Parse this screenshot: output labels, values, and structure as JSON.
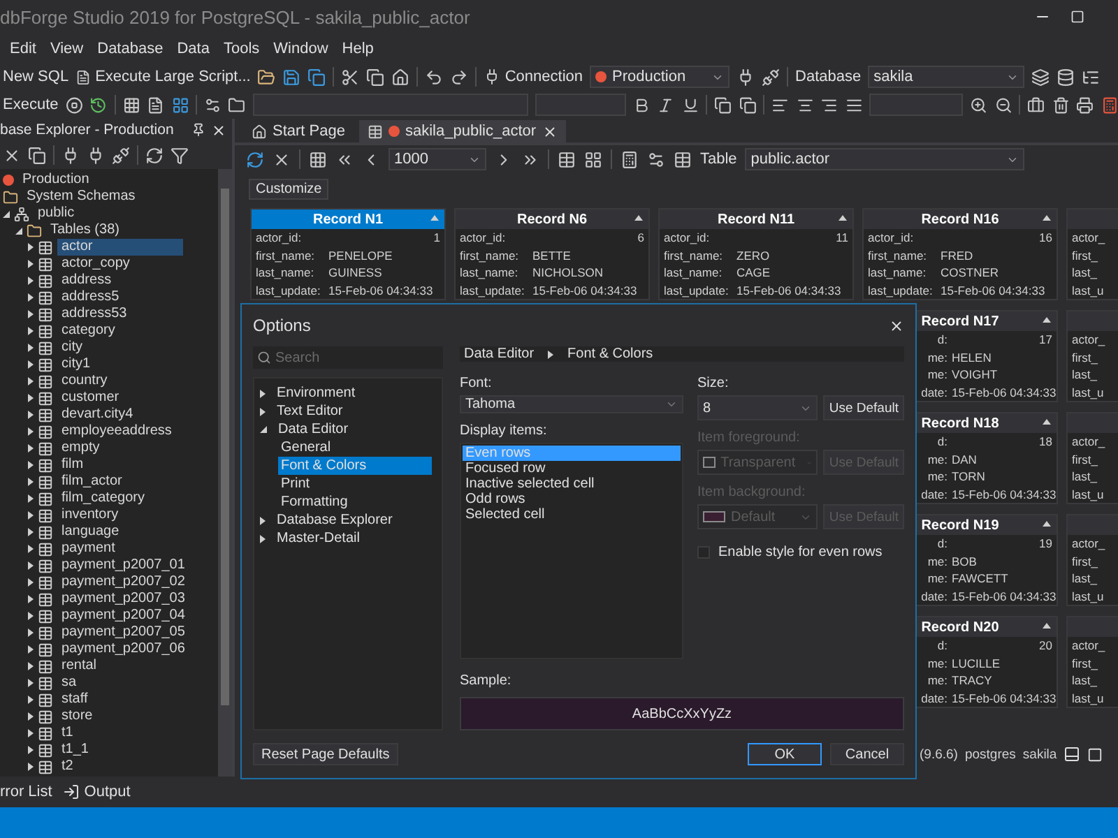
{
  "window": {
    "title": "dbForge Studio 2019 for PostgreSQL - sakila_public_actor"
  },
  "menu": [
    "Edit",
    "View",
    "Database",
    "Data",
    "Tools",
    "Window",
    "Help"
  ],
  "toolbar": {
    "new_sql": "New SQL",
    "execute_large_script": "Execute Large Script...",
    "connection_label": "Connection",
    "connection": "Production",
    "database_label": "Database",
    "database": "sakila",
    "execute": "Execute"
  },
  "explorer": {
    "title": "base Explorer - Production",
    "tree": [
      {
        "label": "Production",
        "kind": "connection",
        "selected": false
      },
      {
        "label": "System Schemas",
        "kind": "folder",
        "selected": false
      },
      {
        "label": "public",
        "kind": "schema",
        "expanded": true,
        "selected": false,
        "children": [
          {
            "label": "Tables (38)",
            "kind": "folder",
            "expanded": true,
            "selected": false,
            "children": [
              {
                "label": "actor",
                "kind": "table",
                "expanded": false,
                "selected": true
              },
              {
                "label": "actor_copy",
                "kind": "table",
                "expanded": false,
                "selected": false
              },
              {
                "label": "address",
                "kind": "table",
                "expanded": false,
                "selected": false
              },
              {
                "label": "address5",
                "kind": "table",
                "expanded": false,
                "selected": false
              },
              {
                "label": "address53",
                "kind": "table",
                "expanded": false,
                "selected": false
              },
              {
                "label": "category",
                "kind": "table",
                "expanded": false,
                "selected": false
              },
              {
                "label": "city",
                "kind": "table",
                "expanded": false,
                "selected": false
              },
              {
                "label": "city1",
                "kind": "table",
                "expanded": false,
                "selected": false
              },
              {
                "label": "country",
                "kind": "table",
                "expanded": false,
                "selected": false
              },
              {
                "label": "customer",
                "kind": "table",
                "expanded": false,
                "selected": false
              },
              {
                "label": "devart.city4",
                "kind": "table",
                "expanded": false,
                "selected": false
              },
              {
                "label": "employeeaddress",
                "kind": "table",
                "expanded": false,
                "selected": false
              },
              {
                "label": "empty",
                "kind": "table",
                "expanded": false,
                "selected": false
              },
              {
                "label": "film",
                "kind": "table",
                "expanded": false,
                "selected": false
              },
              {
                "label": "film_actor",
                "kind": "table",
                "expanded": false,
                "selected": false
              },
              {
                "label": "film_category",
                "kind": "table",
                "expanded": false,
                "selected": false
              },
              {
                "label": "inventory",
                "kind": "table",
                "expanded": false,
                "selected": false
              },
              {
                "label": "language",
                "kind": "table",
                "expanded": false,
                "selected": false
              },
              {
                "label": "payment",
                "kind": "table",
                "expanded": false,
                "selected": false
              },
              {
                "label": "payment_p2007_01",
                "kind": "table",
                "expanded": false,
                "selected": false
              },
              {
                "label": "payment_p2007_02",
                "kind": "table",
                "expanded": false,
                "selected": false
              },
              {
                "label": "payment_p2007_03",
                "kind": "table",
                "expanded": false,
                "selected": false
              },
              {
                "label": "payment_p2007_04",
                "kind": "table",
                "expanded": false,
                "selected": false
              },
              {
                "label": "payment_p2007_05",
                "kind": "table",
                "expanded": false,
                "selected": false
              },
              {
                "label": "payment_p2007_06",
                "kind": "table",
                "expanded": false,
                "selected": false
              },
              {
                "label": "rental",
                "kind": "table",
                "expanded": false,
                "selected": false
              },
              {
                "label": "sa",
                "kind": "table",
                "expanded": false,
                "selected": false
              },
              {
                "label": "staff",
                "kind": "table",
                "expanded": false,
                "selected": false
              },
              {
                "label": "store",
                "kind": "table",
                "expanded": false,
                "selected": false
              },
              {
                "label": "t1",
                "kind": "table",
                "expanded": false,
                "selected": false
              },
              {
                "label": "t1_1",
                "kind": "table",
                "expanded": false,
                "selected": false
              },
              {
                "label": "t2",
                "kind": "table",
                "expanded": false,
                "selected": false
              }
            ]
          }
        ]
      }
    ]
  },
  "tabs": [
    {
      "label": "Start Page",
      "selected": false
    },
    {
      "label": "sakila_public_actor",
      "selected": true
    }
  ],
  "data_toolbar": {
    "row_limit": "1000",
    "table_label": "Table",
    "table": "public.actor",
    "customize": "Customize"
  },
  "record_rows": [
    {
      "cards": [
        {
          "title": "Record N1",
          "selected": true,
          "fields": [
            {
              "label": "actor_id:",
              "value": "1",
              "kind": "number"
            },
            {
              "label": "first_name:",
              "value": "PENELOPE"
            },
            {
              "label": "last_name:",
              "value": "GUINESS"
            },
            {
              "label": "last_update:",
              "value": "15-Feb-06 04:34:33"
            }
          ]
        },
        {
          "title": "Record N6",
          "selected": false,
          "fields": [
            {
              "label": "actor_id:",
              "value": "6",
              "kind": "number"
            },
            {
              "label": "first_name:",
              "value": "BETTE"
            },
            {
              "label": "last_name:",
              "value": "NICHOLSON"
            },
            {
              "label": "last_update:",
              "value": "15-Feb-06 04:34:33"
            }
          ]
        },
        {
          "title": "Record N11",
          "selected": false,
          "fields": [
            {
              "label": "actor_id:",
              "value": "11",
              "kind": "number"
            },
            {
              "label": "first_name:",
              "value": "ZERO"
            },
            {
              "label": "last_name:",
              "value": "CAGE"
            },
            {
              "label": "last_update:",
              "value": "15-Feb-06 04:34:33"
            }
          ]
        },
        {
          "title": "Record N16",
          "selected": false,
          "fields": [
            {
              "label": "actor_id:",
              "value": "16",
              "kind": "number"
            },
            {
              "label": "first_name:",
              "value": "FRED"
            },
            {
              "label": "last_name:",
              "value": "COSTNER"
            },
            {
              "label": "last_update:",
              "value": "15-Feb-06 04:34:33"
            }
          ]
        },
        {
          "selected": false,
          "fields": [
            {
              "label": "actor_"
            },
            {
              "label": "first_"
            },
            {
              "label": "last_"
            },
            {
              "label": "last_u"
            }
          ]
        }
      ]
    },
    {
      "cards": [
        {
          "title": "Record N17",
          "selected": false,
          "covered": true,
          "fields": [
            {
              "label": "d:",
              "value": "17",
              "kind": "number"
            },
            {
              "label": "me:",
              "value": "HELEN"
            },
            {
              "label": "me:",
              "value": "VOIGHT"
            },
            {
              "label": "date:",
              "value": "15-Feb-06 04:34:33"
            }
          ]
        },
        {
          "selected": false,
          "fields": [
            {
              "label": "actor_"
            },
            {
              "label": "first_"
            },
            {
              "label": "last_"
            },
            {
              "label": "last_u"
            }
          ]
        }
      ]
    },
    {
      "cards": [
        {
          "title": "Record N18",
          "selected": false,
          "covered": true,
          "fields": [
            {
              "label": "d:",
              "value": "18",
              "kind": "number"
            },
            {
              "label": "me:",
              "value": "DAN"
            },
            {
              "label": "me:",
              "value": "TORN"
            },
            {
              "label": "date:",
              "value": "15-Feb-06 04:34:33"
            }
          ]
        },
        {
          "selected": false,
          "fields": [
            {
              "label": "actor_"
            },
            {
              "label": "first_"
            },
            {
              "label": "last_"
            },
            {
              "label": "last_u"
            }
          ]
        }
      ]
    },
    {
      "cards": [
        {
          "title": "Record N19",
          "selected": false,
          "covered": true,
          "fields": [
            {
              "label": "d:",
              "value": "19",
              "kind": "number"
            },
            {
              "label": "me:",
              "value": "BOB"
            },
            {
              "label": "me:",
              "value": "FAWCETT"
            },
            {
              "label": "date:",
              "value": "15-Feb-06 04:34:33"
            }
          ]
        },
        {
          "selected": false,
          "fields": [
            {
              "label": "actor_"
            },
            {
              "label": "first_"
            },
            {
              "label": "last_"
            },
            {
              "label": "last_u"
            }
          ]
        }
      ]
    },
    {
      "cards": [
        {
          "title": "Record N20",
          "selected": false,
          "covered": true,
          "fields": [
            {
              "label": "d:",
              "value": "20",
              "kind": "number"
            },
            {
              "label": "me:",
              "value": "LUCILLE"
            },
            {
              "label": "me:",
              "value": "TRACY"
            },
            {
              "label": "date:",
              "value": "15-Feb-06 04:34:33"
            }
          ]
        },
        {
          "selected": false,
          "fields": [
            {
              "label": "actor_"
            },
            {
              "label": "first_"
            },
            {
              "label": "last_"
            },
            {
              "label": "last_u"
            }
          ]
        }
      ]
    }
  ],
  "doc_status": [
    "(9.6.6)",
    "postgres",
    "sakila"
  ],
  "dialog": {
    "title": "Options",
    "search": {
      "placeholder": "Search"
    },
    "tree": [
      {
        "label": "Environment",
        "expanded": false,
        "selected": false
      },
      {
        "label": "Text Editor",
        "expanded": false,
        "selected": false
      },
      {
        "label": "Data Editor",
        "expanded": true,
        "selected": false,
        "children": [
          {
            "label": "General",
            "selected": false
          },
          {
            "label": "Font & Colors",
            "selected": true
          },
          {
            "label": "Print",
            "selected": false
          },
          {
            "label": "Formatting",
            "selected": false
          }
        ]
      },
      {
        "label": "Database Explorer",
        "expanded": false,
        "selected": false
      },
      {
        "label": "Master-Detail",
        "expanded": false,
        "selected": false
      }
    ],
    "breadcrumb": [
      "Data Editor",
      "Font & Colors"
    ],
    "font": {
      "label": "Font:",
      "value": "Tahoma"
    },
    "size": {
      "label": "Size:",
      "value": "8",
      "button": "Use Default"
    },
    "display_items": {
      "label": "Display items:",
      "items": [
        {
          "label": "Even rows",
          "selected": true
        },
        {
          "label": "Focused row",
          "selected": false
        },
        {
          "label": "Inactive selected cell",
          "selected": false
        },
        {
          "label": "Odd rows",
          "selected": false
        },
        {
          "label": "Selected cell",
          "selected": false
        }
      ]
    },
    "item_foreground": {
      "label": "Item foreground:",
      "value": "Transparent",
      "button": "Use Default",
      "disabled": true
    },
    "item_background": {
      "label": "Item background:",
      "value": "Default",
      "button": "Use Default",
      "disabled": true
    },
    "even_rows_style": {
      "label": "Enable style for even rows",
      "checked": false
    },
    "sample": {
      "label": "Sample:",
      "text": "AaBbCcXxYyZz"
    },
    "buttons": {
      "reset": "Reset Page Defaults",
      "ok": "OK",
      "cancel": "Cancel"
    }
  },
  "bottom_tabs": [
    "rror List",
    "Output"
  ]
}
